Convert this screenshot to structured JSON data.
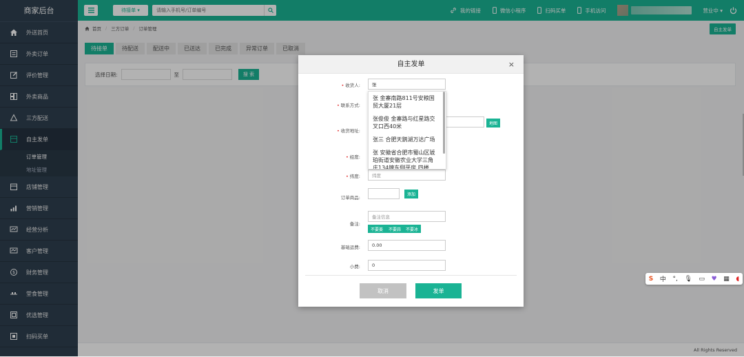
{
  "brand": "商家后台",
  "sidebar": {
    "items": [
      {
        "label": "外送首页",
        "icon": "home-icon"
      },
      {
        "label": "外卖订单",
        "icon": "order-list-icon"
      },
      {
        "label": "评价管理",
        "icon": "edit-icon"
      },
      {
        "label": "外卖商品",
        "icon": "grid-icon"
      },
      {
        "label": "三方配送",
        "icon": "delivery-icon"
      },
      {
        "label": "自主发单",
        "icon": "send-order-icon"
      },
      {
        "label": "店铺管理",
        "icon": "store-icon"
      },
      {
        "label": "营销管理",
        "icon": "marketing-icon"
      },
      {
        "label": "经营分析",
        "icon": "analysis-icon"
      },
      {
        "label": "客户管理",
        "icon": "customer-icon"
      },
      {
        "label": "财务管理",
        "icon": "finance-icon"
      },
      {
        "label": "堂食管理",
        "icon": "dine-in-icon"
      },
      {
        "label": "优选管理",
        "icon": "select-icon"
      },
      {
        "label": "扫码买单",
        "icon": "scan-pay-icon"
      }
    ],
    "subitems": [
      "订单管理",
      "地址管理"
    ]
  },
  "topbar": {
    "select_label": "待接单 ▾",
    "search_placeholder": "请输入手机号/订单编号",
    "links": [
      "我的链接",
      "微信小程序",
      "扫码买单",
      "手机访问"
    ],
    "status": "营业中 ▾"
  },
  "breadcrumb": [
    "首页",
    "三方订单",
    "订单管理"
  ],
  "self_order_button": "自主发单",
  "tabs": [
    "待接单",
    "待配送",
    "配送中",
    "已送达",
    "已完成",
    "异常订单",
    "已取消"
  ],
  "filter": {
    "label": "选择日期:",
    "to": "至",
    "search_button": "搜 索"
  },
  "modal": {
    "title": "自主发单",
    "close": "×",
    "fields": {
      "receiver_label": "收货人:",
      "receiver_value": "张",
      "contact_label": "联系方式:",
      "address_label": "收货地址:",
      "map_button": "地图",
      "lng_label": "经度:",
      "lat_label": "纬度:",
      "lat_placeholder": "纬度",
      "goods_label": "订单商品:",
      "add_button": "添加",
      "remark_label": "备注:",
      "remark_placeholder": "备注信息",
      "tags": [
        "不要姜",
        "不要蒜",
        "不要冰"
      ],
      "delivery_fee_label": "基础运费:",
      "delivery_fee_value": "0.00",
      "tip_label": "小费:",
      "tip_value": "0"
    },
    "suggestions": [
      "张 金寨南路811号安粮国贸大厦21层",
      "张俊俊 金寨路与红星路交叉口西40米",
      "张三 合肥天鹅湖万达广场",
      "张 安徽省合肥市蜀山区琥珀街道安徽农业大学三角庄134幢东侧平房 四楼"
    ],
    "cancel": "取消",
    "submit": "发单"
  },
  "footer": "All Rights Reserved",
  "ime": {
    "zh": "中"
  },
  "colors": {
    "accent": "#1ab394",
    "sidebar": "#2f4050",
    "required": "#e02222"
  }
}
